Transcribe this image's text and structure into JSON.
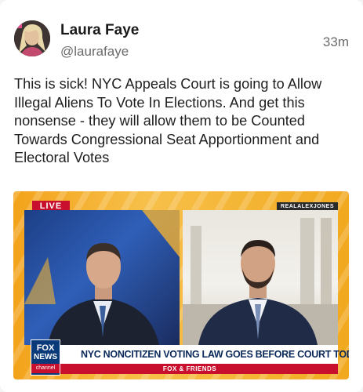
{
  "post": {
    "author_name": "Laura Faye",
    "author_handle": "@laurafaye",
    "time": "33m",
    "text": "This is sick! NYC Appeals Court is going to Allow Illegal Aliens To Vote In Elections. And get this nonsense - they will allow them to be Counted Towards Congressional Seat Apportionment and Electoral Votes"
  },
  "media": {
    "live_label": "LIVE",
    "handle_bug": "REALALEXJONES",
    "headline": "NYC NONCITIZEN VOTING LAW GOES BEFORE COURT TODAY",
    "show_label": "FOX & FRIENDS",
    "logo_line1": "FOX",
    "logo_line2": "NEWS",
    "logo_line3": "channel"
  }
}
